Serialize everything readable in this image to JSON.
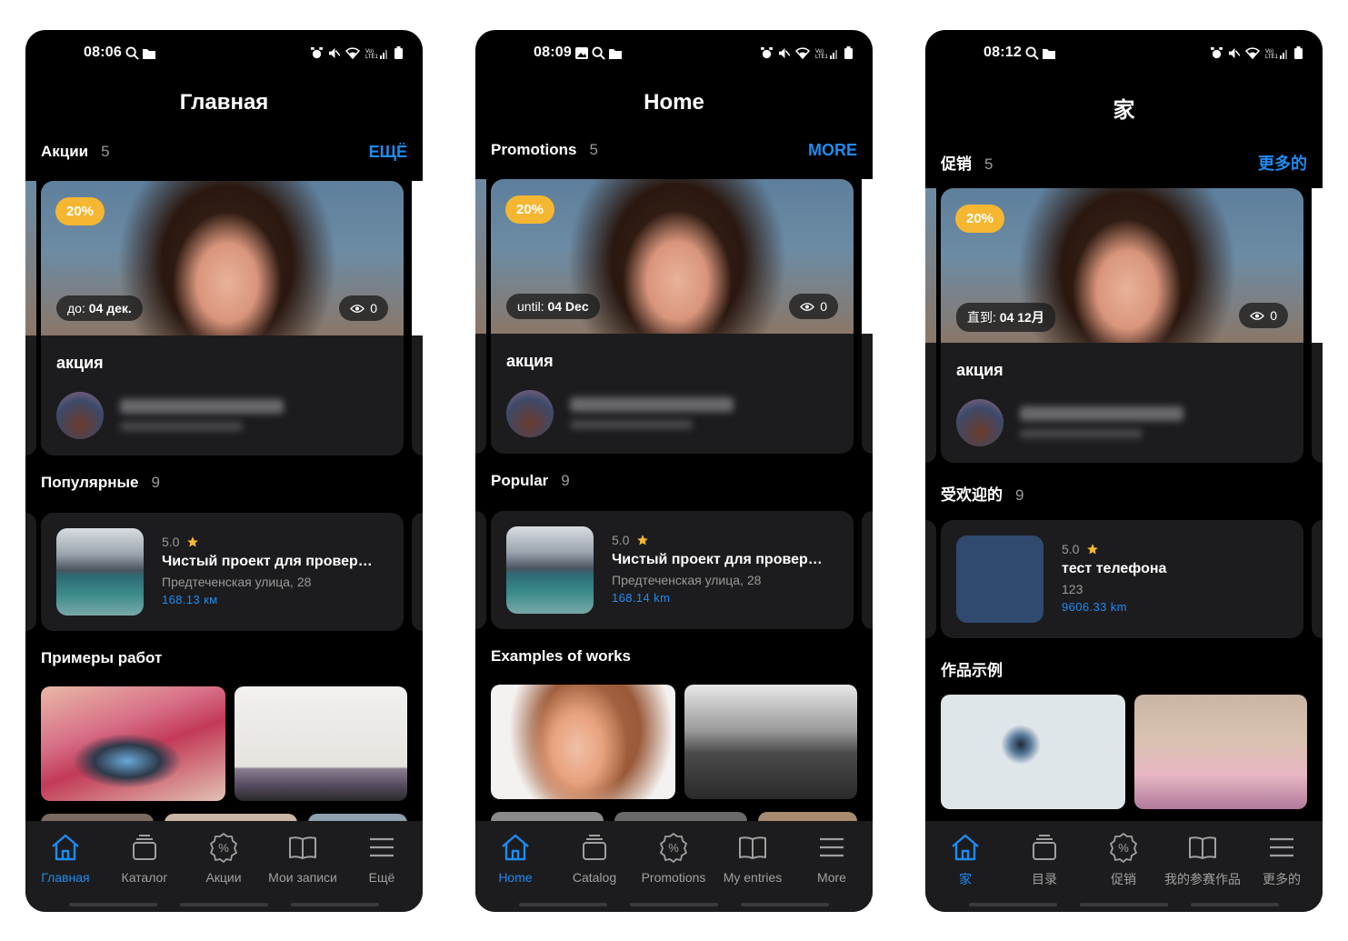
{
  "accent_color": "#1e8bf0",
  "badge_color": "#f5b731",
  "screens": [
    {
      "status": {
        "time": "08:06"
      },
      "title": "Главная",
      "promotions": {
        "label": "Акции",
        "count": "5",
        "more": "ЕЩЁ",
        "card": {
          "discount": "20%",
          "date_prefix": "до:",
          "date_value": "04 дек.",
          "views": "0",
          "name": "акция"
        }
      },
      "popular": {
        "label": "Популярные",
        "count": "9",
        "card": {
          "rating": "5.0",
          "name": "Чистый проект для провер…",
          "address": "Предтеченская улица, 28",
          "distance": "168.13 км"
        }
      },
      "works": {
        "label": "Примеры работ"
      },
      "nav": [
        "Главная",
        "Каталог",
        "Акции",
        "Мои записи",
        "Ещё"
      ]
    },
    {
      "status": {
        "time": "08:09"
      },
      "title": "Home",
      "promotions": {
        "label": "Promotions",
        "count": "5",
        "more": "MORE",
        "card": {
          "discount": "20%",
          "date_prefix": "until:",
          "date_value": "04 Dec",
          "views": "0",
          "name": "акция"
        }
      },
      "popular": {
        "label": "Popular",
        "count": "9",
        "card": {
          "rating": "5.0",
          "name": "Чистый проект для провер…",
          "address": "Предтеченская улица, 28",
          "distance": "168.14 km"
        }
      },
      "works": {
        "label": "Examples of works"
      },
      "nav": [
        "Home",
        "Catalog",
        "Promotions",
        "My entries",
        "More"
      ]
    },
    {
      "status": {
        "time": "08:12"
      },
      "title": "家",
      "promotions": {
        "label": "促销",
        "count": "5",
        "more": "更多的",
        "card": {
          "discount": "20%",
          "date_prefix": "直到:",
          "date_value": "04 12月",
          "views": "0",
          "name": "акция"
        }
      },
      "popular": {
        "label": "受欢迎的",
        "count": "9",
        "card": {
          "rating": "5.0",
          "name": "тест телефона",
          "address": "123",
          "distance": "9606.33 km"
        }
      },
      "works": {
        "label": "作品示例"
      },
      "nav": [
        "家",
        "目录",
        "促销",
        "我的参赛作品",
        "更多的"
      ]
    }
  ],
  "icons": {
    "search": "search-icon",
    "folder": "folder-icon",
    "alarm": "alarm-icon",
    "mute": "mute-icon",
    "wifi": "wifi-icon",
    "signal": "signal-icon",
    "battery": "battery-icon",
    "eye": "eye-icon",
    "star": "star-icon",
    "home": "home-icon",
    "catalog": "catalog-icon",
    "discount": "discount-icon",
    "book": "book-icon",
    "menu": "menu-icon"
  }
}
